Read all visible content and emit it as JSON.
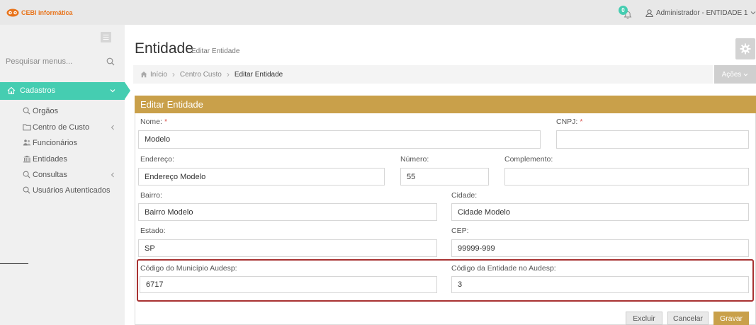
{
  "topbar": {
    "brand": "CEBI informática",
    "notification_count": "0",
    "user_label": "Administrador - ENTIDADE 1"
  },
  "sidebar": {
    "search_placeholder": "Pesquisar menus...",
    "active_menu": {
      "label": "Cadastros",
      "icon": "home-icon"
    },
    "items": [
      {
        "label": "Orgãos",
        "icon": "search-icon"
      },
      {
        "label": "Centro de Custo",
        "icon": "folder-icon",
        "has_submenu": true
      },
      {
        "label": "Funcionários",
        "icon": "users-icon"
      },
      {
        "label": "Entidades",
        "icon": "bank-icon"
      },
      {
        "label": "Consultas",
        "icon": "search-icon",
        "has_submenu": true
      },
      {
        "label": "Usuários Autenticados",
        "icon": "search-icon"
      }
    ]
  },
  "header": {
    "title": "Entidade",
    "subtitle": "Editar Entidade"
  },
  "breadcrumb": [
    "Início",
    "Centro Custo",
    "Editar Entidade"
  ],
  "actions_label": "Ações",
  "panel": {
    "title": "Editar Entidade",
    "required_mark": "*",
    "fields": {
      "nome": {
        "label": "Nome:",
        "value": "Modelo",
        "required": true
      },
      "cnpj": {
        "label": "CNPJ:",
        "value": "",
        "required": true
      },
      "endereco": {
        "label": "Endereço:",
        "value": "Endereço Modelo"
      },
      "numero": {
        "label": "Número:",
        "value": "55"
      },
      "complemento": {
        "label": "Complemento:",
        "value": ""
      },
      "bairro": {
        "label": "Bairro:",
        "value": "Bairro Modelo"
      },
      "cidade": {
        "label": "Cidade:",
        "value": "Cidade Modelo"
      },
      "estado": {
        "label": "Estado:",
        "value": "SP"
      },
      "cep": {
        "label": "CEP:",
        "value": "99999-999"
      },
      "codigo_municipio": {
        "label": "Código do Município Audesp:",
        "value": "6717"
      },
      "codigo_entidade": {
        "label": "Código da Entidade no Audesp:",
        "value": "3"
      }
    }
  },
  "buttons": {
    "delete": "Excluir",
    "cancel": "Cancelar",
    "save": "Gravar"
  },
  "colors": {
    "accent_teal": "#45cdb1",
    "panel_gold": "#c9a04a",
    "highlight_red": "#a83232",
    "brand_orange": "#e8731a"
  }
}
